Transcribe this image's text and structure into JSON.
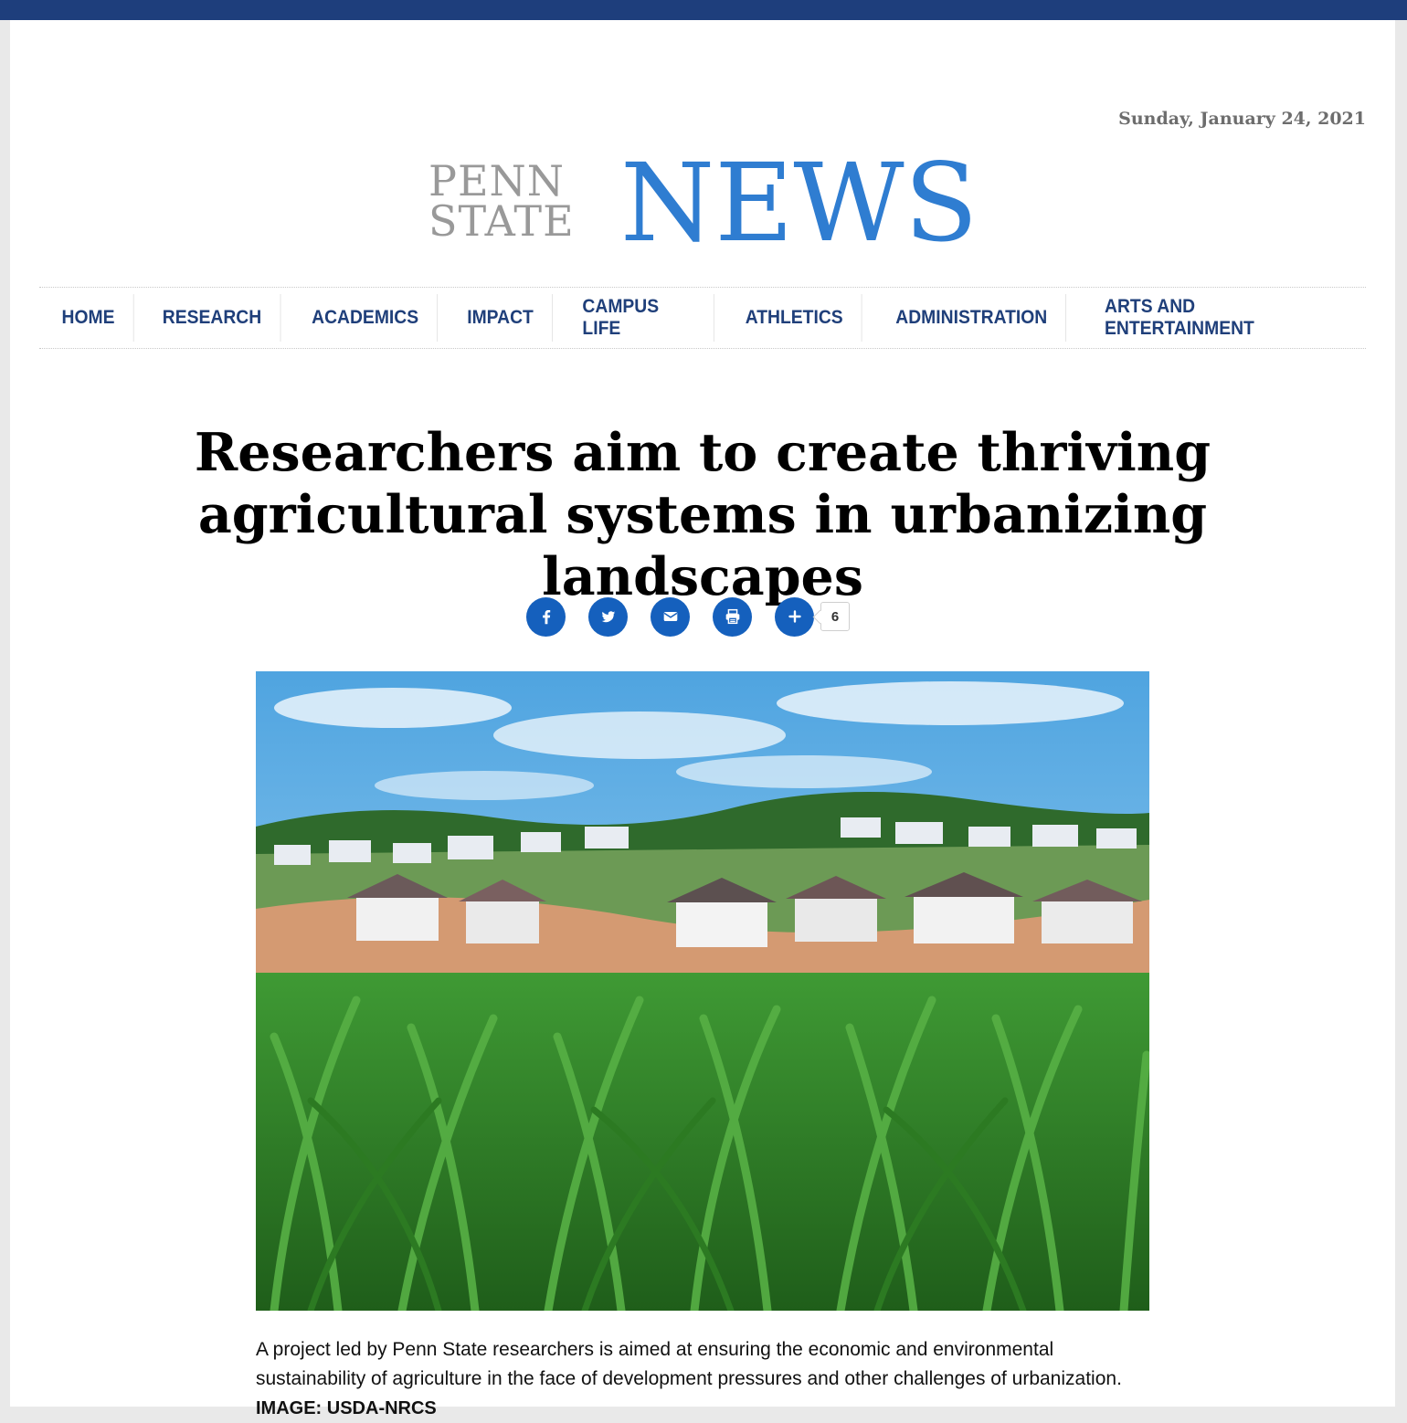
{
  "header": {
    "date": "Sunday, January 24, 2021",
    "logo_line1": "PENN",
    "logo_line2": "STATE",
    "logo_news": "NEWS"
  },
  "nav": {
    "items": [
      {
        "label": "HOME"
      },
      {
        "label": "RESEARCH"
      },
      {
        "label": "ACADEMICS"
      },
      {
        "label": "IMPACT"
      },
      {
        "label": "CAMPUS LIFE"
      },
      {
        "label": "ATHLETICS"
      },
      {
        "label": "ADMINISTRATION"
      },
      {
        "label": "ARTS AND ENTERTAINMENT"
      }
    ]
  },
  "article": {
    "headline": "Researchers aim to create thriving agricultural systems in urbanizing landscapes",
    "share_count": "6",
    "share_icons": [
      "facebook-icon",
      "twitter-icon",
      "email-icon",
      "print-icon",
      "plus-icon"
    ],
    "caption": "A project led by Penn State researchers is aimed at ensuring the economic and environmental sustainability of agriculture in the face of development pressures and other challenges of urbanization.",
    "credit": "IMAGE: USDA-NRCS"
  },
  "colors": {
    "brand_blue": "#1e3e7c",
    "news_blue": "#2f7dd1",
    "share_blue": "#1560bd"
  }
}
